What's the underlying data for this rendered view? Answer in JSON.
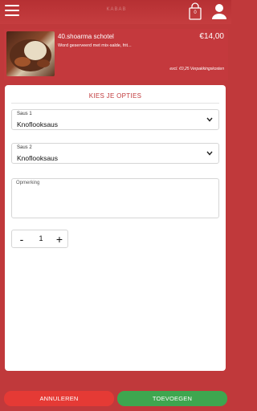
{
  "header": {
    "logo_text": "KABAB",
    "cart_count": "0"
  },
  "product": {
    "name": "40.shoarma schotel",
    "price": "€14,00",
    "description": "Word geserveerd met mix-salde, frit...",
    "fee_note": "excl. €0,25 Verpakkingskosten"
  },
  "options": {
    "title": "KIES JE OPTIES",
    "sauce1": {
      "label": "Saus 1",
      "value": "Knoflooksaus"
    },
    "sauce2": {
      "label": "Saus 2",
      "value": "Knoflooksaus"
    },
    "remark": {
      "label": "Opmerking",
      "value": ""
    },
    "quantity": {
      "minus": "-",
      "value": "1",
      "plus": "+"
    }
  },
  "actions": {
    "cancel_label": "ANNULEREN",
    "add_label": "TOEVOEGEN"
  },
  "colors": {
    "brand_red": "#c0393b",
    "cancel_red": "#e53a35",
    "confirm_green": "#3ea64f"
  }
}
